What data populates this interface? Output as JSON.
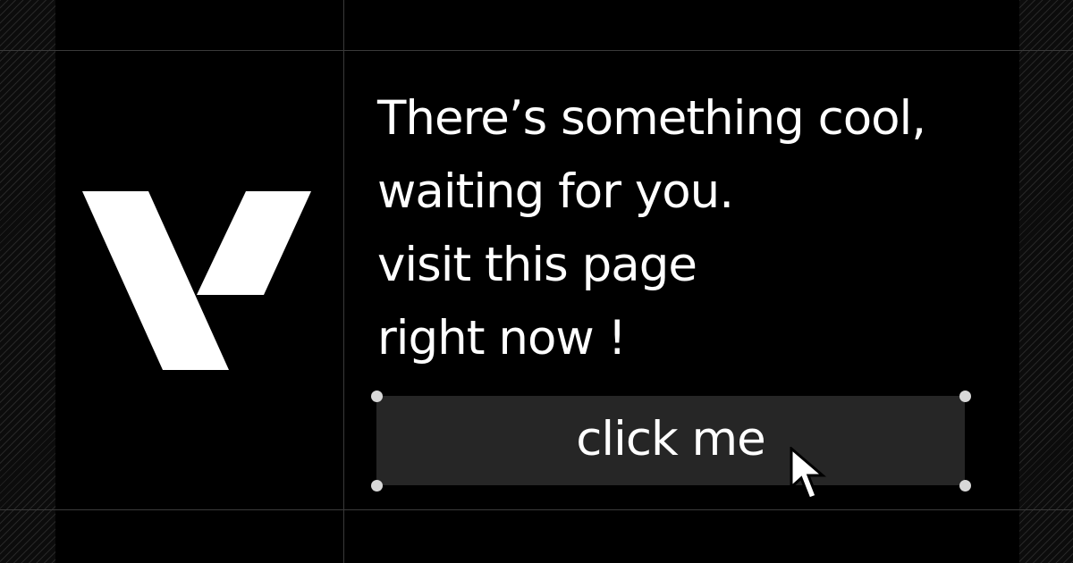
{
  "brand": {
    "logo": "v-logo-icon",
    "logo_color": "#ffffff"
  },
  "headline": {
    "text": "There’s something cool,\nwaiting for you.\nvisit this page\nright now !"
  },
  "cta": {
    "label": "click me",
    "background_color": "#262626",
    "text_color": "#ffffff"
  },
  "selection": {
    "handle_color": "#d8d8d8"
  },
  "pointer": {
    "icon": "arrow-cursor-icon"
  },
  "theme": {
    "background": "#000000",
    "guide_line_color": "#3a3a3a"
  }
}
